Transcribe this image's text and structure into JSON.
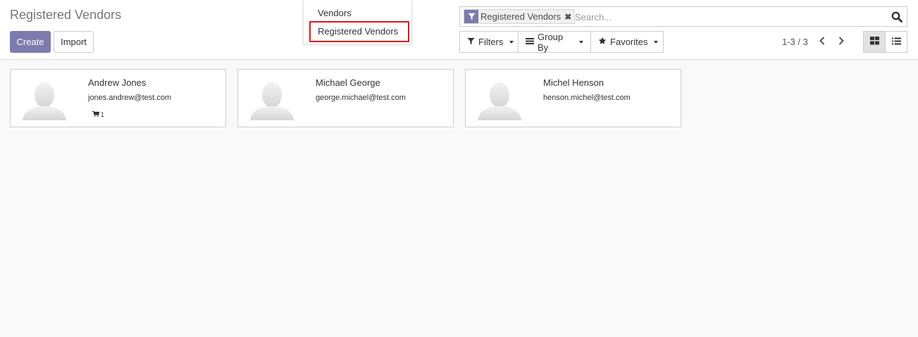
{
  "page": {
    "title": "Registered Vendors"
  },
  "buttons": {
    "create": "Create",
    "import": "Import"
  },
  "dropdown": {
    "items": [
      {
        "label": "Vendors"
      },
      {
        "label": "Registered Vendors",
        "highlighted": true
      }
    ]
  },
  "search": {
    "facet_label": "Registered Vendors",
    "facet_icon": "filter-icon",
    "placeholder": "Search...",
    "value": ""
  },
  "filter_bar": {
    "filters": "Filters",
    "group_by": "Group By",
    "favorites": "Favorites"
  },
  "pager": {
    "text": "1-3 / 3"
  },
  "views": {
    "active": "kanban",
    "options": [
      "kanban",
      "list"
    ]
  },
  "vendors": [
    {
      "name": "Andrew Jones",
      "email": "jones.andrew@test.com",
      "cart_count": "1"
    },
    {
      "name": "Michael George",
      "email": "george.michael@test.com"
    },
    {
      "name": "Michel Henson",
      "email": "henson.michel@test.com"
    }
  ],
  "colors": {
    "primary": "#7c7bad",
    "highlight": "#e0141c"
  }
}
